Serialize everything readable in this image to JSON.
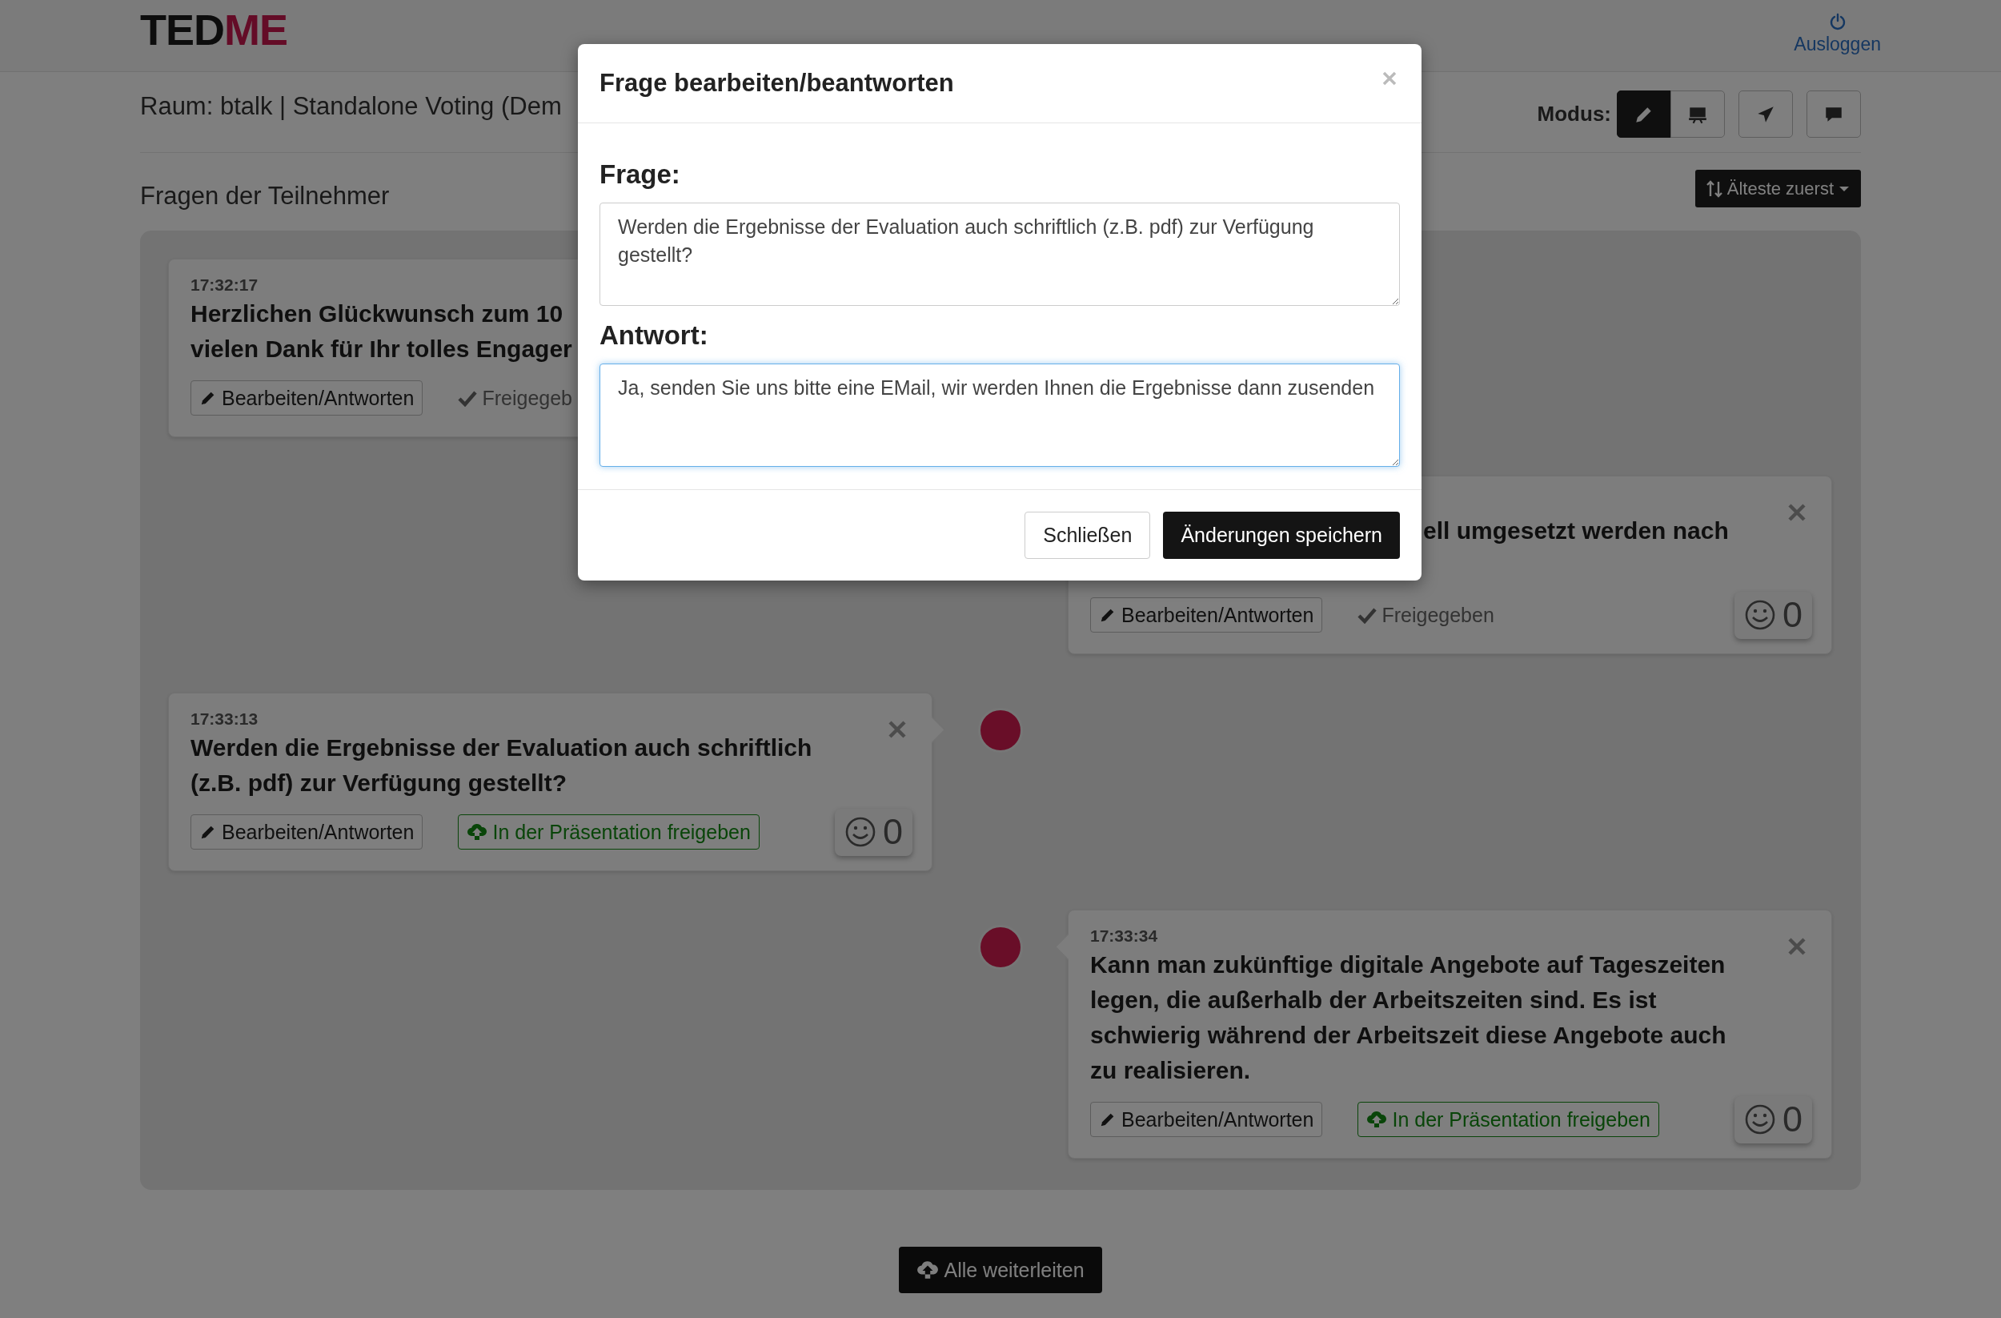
{
  "header": {
    "logo": {
      "dark": "TED",
      "accent": "ME"
    },
    "logout": "Ausloggen"
  },
  "room_title": "Raum: btalk | Standalone Voting (Dem",
  "mode": {
    "label": "Modus:",
    "groups": [
      [
        {
          "selected": true
        },
        {
          "selected": false
        }
      ],
      [
        {
          "selected": false
        }
      ],
      [
        {
          "selected": false
        }
      ]
    ]
  },
  "section_title": "Fragen der Teilnehmer",
  "sort_button": "Älteste zuerst",
  "questions": [
    {
      "time": "17:32:17",
      "lines": [
        "Herzlichen Glückwunsch zum 10",
        "vielen Dank für Ihr tolles Engager"
      ],
      "edit_button": "Bearbeiten/Antworten",
      "release": {
        "kind": "released",
        "label": "Freigegeb"
      }
    },
    {
      "covered_left": true,
      "closable": true,
      "lines": [
        "ell umgesetzt werden nach"
      ],
      "edit_button": "Bearbeiten/Antworten",
      "release": {
        "kind": "released",
        "label": "Freigegeben"
      },
      "likes": "0"
    },
    {
      "marker": true,
      "closable": true,
      "time": "17:33:13",
      "lines": [
        "Werden die Ergebnisse der Evaluation auch schriftlich",
        "(z.B. pdf) zur Verfügung gestellt?"
      ],
      "edit_button": "Bearbeiten/Antworten",
      "release": {
        "kind": "button",
        "label": "In der Präsentation freigeben"
      },
      "likes": "0"
    },
    {
      "marker": true,
      "closable": true,
      "time": "17:33:34",
      "lines": [
        "Kann man zukünftige digitale Angebote auf Tageszeiten",
        "legen, die außerhalb der Arbeitszeiten sind. Es ist",
        "schwierig während der Arbeitszeit diese Angebote auch",
        "zu realisieren."
      ],
      "edit_button": "Bearbeiten/Antworten",
      "release": {
        "kind": "button",
        "label": "In der Präsentation freigeben"
      },
      "likes": "0"
    }
  ],
  "forward_all_button": "Alle weiterleiten",
  "modal": {
    "title": "Frage bearbeiten/beantworten",
    "fields": [
      {
        "label": "Frage:",
        "value": "Werden die Ergebnisse der Evaluation auch schriftlich (z.B. pdf) zur Verfügung gestellt?",
        "focused": false
      },
      {
        "label": "Antwort:",
        "value": "Ja, senden Sie uns bitte eine EMail, wir werden Ihnen die Ergebnisse dann zusenden",
        "focused": true
      }
    ],
    "buttons": [
      {
        "label": "Schließen",
        "kind": "default"
      },
      {
        "label": "Änderungen speichern",
        "kind": "primary"
      }
    ]
  }
}
